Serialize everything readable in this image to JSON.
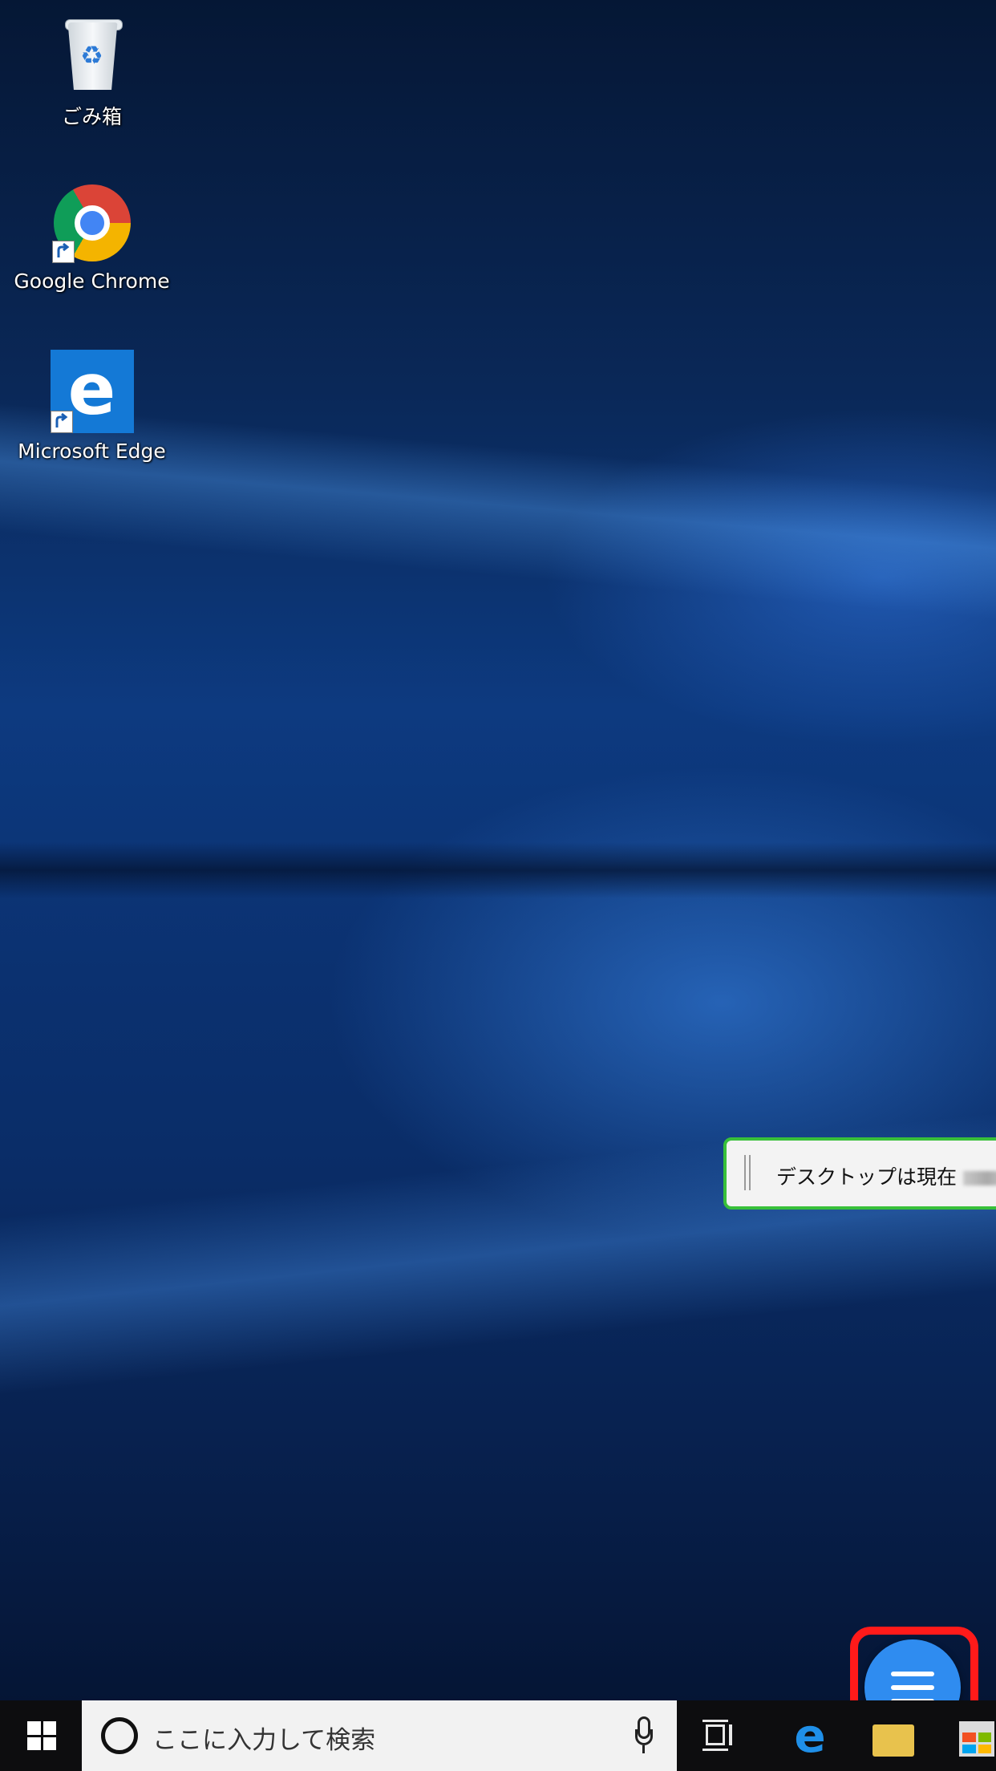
{
  "desktop": {
    "icons": [
      {
        "label": "ごみ箱",
        "icon": "recycle-bin-icon"
      },
      {
        "label": "Google Chrome",
        "icon": "chrome-icon",
        "shortcut": true
      },
      {
        "label": "Microsoft Edge",
        "icon": "edge-icon",
        "shortcut": true
      }
    ],
    "wallpaper_colors": {
      "dark": "#051735",
      "mid": "#0d3a80",
      "light": "#5aaaff"
    }
  },
  "notification": {
    "text": "デスクトップは現在",
    "border_color": "#38c03a"
  },
  "taskbar": {
    "search_placeholder": "ここに入力して検索",
    "apps": [
      "task-view-icon",
      "edge-icon",
      "file-explorer-icon",
      "store-icon"
    ]
  },
  "floating_menu": {
    "icon": "hamburger-menu-icon",
    "color": "#2f8cf0",
    "highlight_color": "#ff1a1a"
  }
}
